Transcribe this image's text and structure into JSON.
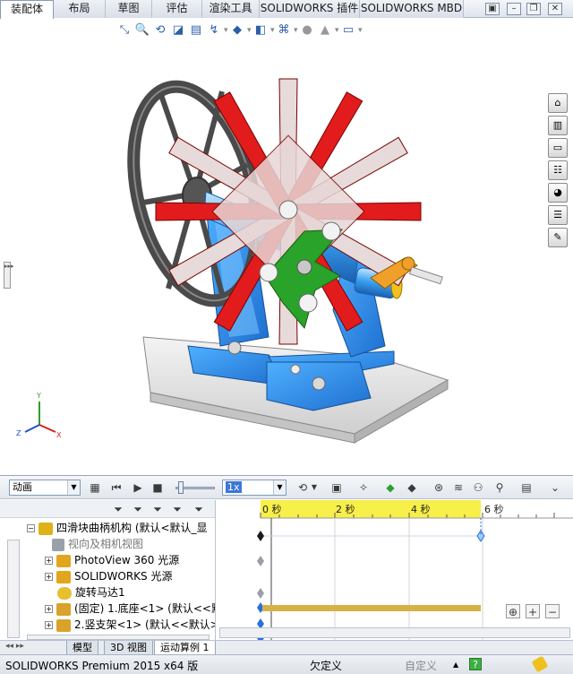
{
  "ribbon": {
    "tabs": [
      {
        "label": "装配体",
        "active": true
      },
      {
        "label": "布局",
        "active": false
      },
      {
        "label": "草图",
        "active": false
      },
      {
        "label": "评估",
        "active": false
      },
      {
        "label": "渲染工具",
        "active": false
      },
      {
        "label": "SOLIDWORKS 插件",
        "active": false
      },
      {
        "label": "SOLIDWORKS MBD",
        "active": false
      }
    ]
  },
  "view_toolbar": {
    "icons": [
      "zoom-to-fit-icon",
      "zoom-area-icon",
      "previous-view-icon",
      "section-view-icon",
      "view-orientation-icon",
      "display-style-icon",
      "hide-show-icon",
      "edit-appearance-icon",
      "apply-scene-icon",
      "view-settings-icon"
    ]
  },
  "task_pane": {
    "icons": [
      "home-icon",
      "design-library-icon",
      "file-explorer-icon",
      "view-palette-icon",
      "appearances-icon",
      "custom-properties-icon",
      "resources-icon"
    ]
  },
  "motion": {
    "study_type": "动画",
    "playback_speed": "1x",
    "timeline_labels": [
      "0 秒",
      "2 秒",
      "4 秒",
      "6 秒"
    ],
    "tree": [
      {
        "label": "四滑块曲柄机构 (默认<默认_显",
        "indent": 0,
        "expand": "−",
        "icon_color": "#e0b21a"
      },
      {
        "label": "视向及相机视图",
        "indent": 1,
        "expand": "",
        "icon_color": "#9aa0a8"
      },
      {
        "label": "PhotoView 360 光源",
        "indent": 1,
        "expand": "+",
        "icon_color": "#e2a51e"
      },
      {
        "label": "SOLIDWORKS 光源",
        "indent": 1,
        "expand": "+",
        "icon_color": "#e2a51e"
      },
      {
        "label": "旋转马达1",
        "indent": 1,
        "expand": "",
        "icon_color": "#e6c030"
      },
      {
        "label": "(固定) 1.底座<1> (默认<<默",
        "indent": 1,
        "expand": "+",
        "icon_color": "#d9a22a"
      },
      {
        "label": "2.竖支架<1> (默认<<默认>",
        "indent": 1,
        "expand": "+",
        "icon_color": "#d9a22a"
      }
    ]
  },
  "bottom_tabs": [
    {
      "label": "模型",
      "active": false
    },
    {
      "label": "3D 视图",
      "active": false
    },
    {
      "label": "运动算例 1",
      "active": true
    }
  ],
  "status": {
    "product": "SOLIDWORKS Premium 2015 x64 版",
    "state": "欠定义",
    "custom": "自定义",
    "help": "?"
  },
  "colors": {
    "timeline_yellow": "#f7ef4a",
    "motor_bar": "#d6b146",
    "key_blue": "#2a6fdb",
    "bracket_blue": "#2f8de4",
    "flywheel": "#4a4a4a"
  }
}
